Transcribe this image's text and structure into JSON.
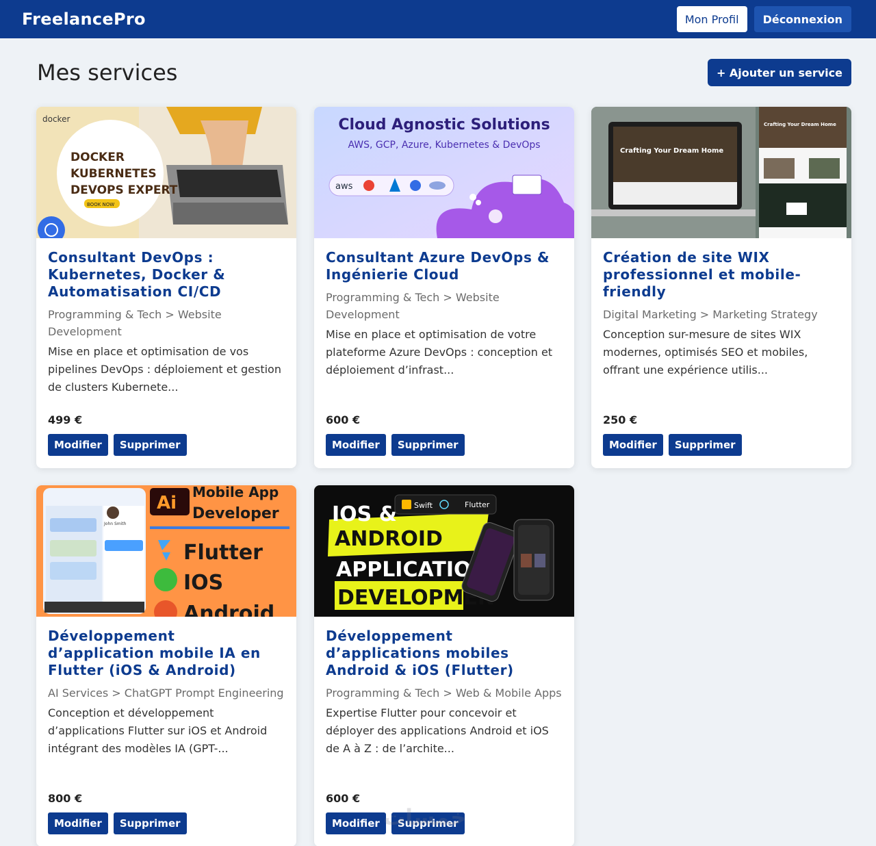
{
  "navbar": {
    "brand": "FreelancePro",
    "profile_label": "Mon Profil",
    "logout_label": "Déconnexion"
  },
  "page": {
    "title": "Mes services",
    "add_label": "+ Ajouter un service"
  },
  "services": [
    {
      "title": "Consultant DevOps : Kubernetes, Docker & Automatisation CI/CD",
      "category": "Programming & Tech > Website Development",
      "description": "Mise en place et optimisation de vos pipelines DevOps : déploiement et gestion de clusters Kubernete...",
      "price": "499 €",
      "edit_label": "Modifier",
      "delete_label": "Supprimer",
      "image": {
        "logo": "docker",
        "lines": [
          "DOCKER",
          "KUBERNETES",
          "DEVOPS EXPERT"
        ],
        "badge": "BOOK NOW"
      }
    },
    {
      "title": "Consultant Azure DevOps & Ingénierie Cloud",
      "category": "Programming & Tech > Website Development",
      "description": "Mise en place et optimisation de votre plateforme Azure DevOps : conception et déploiement d’infrast...",
      "price": "600 €",
      "edit_label": "Modifier",
      "delete_label": "Supprimer",
      "image": {
        "heading": "Cloud Agnostic Solutions",
        "subheading": "AWS, GCP, Azure, Kubernetes & DevOps",
        "chip": "aws"
      }
    },
    {
      "title": "Création de site WIX professionnel et mobile-friendly",
      "category": "Digital Marketing > Marketing Strategy",
      "description": "Conception sur-mesure de sites WIX modernes, optimisés SEO et mobiles, offrant une expérience utilis...",
      "price": "250 €",
      "edit_label": "Modifier",
      "delete_label": "Supprimer",
      "image": {
        "tagline": "Crafting Your Dream Home"
      }
    },
    {
      "title": "Développement d’application mobile IA en Flutter (iOS & Android)",
      "category": "AI Services > ChatGPT Prompt Engineering",
      "description": "Conception et développement d’applications Flutter sur iOS et Android intégrant des modèles IA (GPT-...",
      "price": "800 €",
      "edit_label": "Modifier",
      "delete_label": "Supprimer",
      "image": {
        "badge": "Ai",
        "heading_line1": "Mobile App",
        "heading_line2": "Developer",
        "items": [
          "Flutter",
          "IOS",
          "Android"
        ],
        "person": "John Smith"
      }
    },
    {
      "title": "Développement d’applications mobiles Android & iOS (Flutter)",
      "category": "Programming & Tech > Web & Mobile Apps",
      "description": "Expertise Flutter pour concevoir et déployer des applications Android et iOS de A à Z : de l’archite...",
      "price": "600 €",
      "edit_label": "Modifier",
      "delete_label": "Supprimer",
      "image": {
        "lines": [
          "IOS &",
          "ANDROID",
          "APPLICATION",
          "DEVELOPMEN"
        ],
        "chip_swift": "Swift",
        "chip_flutter": "Flutter"
      }
    }
  ],
  "watermark": "خمسات",
  "colors": {
    "primary": "#0d3b8f",
    "background": "#eef2f6",
    "card": "#ffffff"
  }
}
